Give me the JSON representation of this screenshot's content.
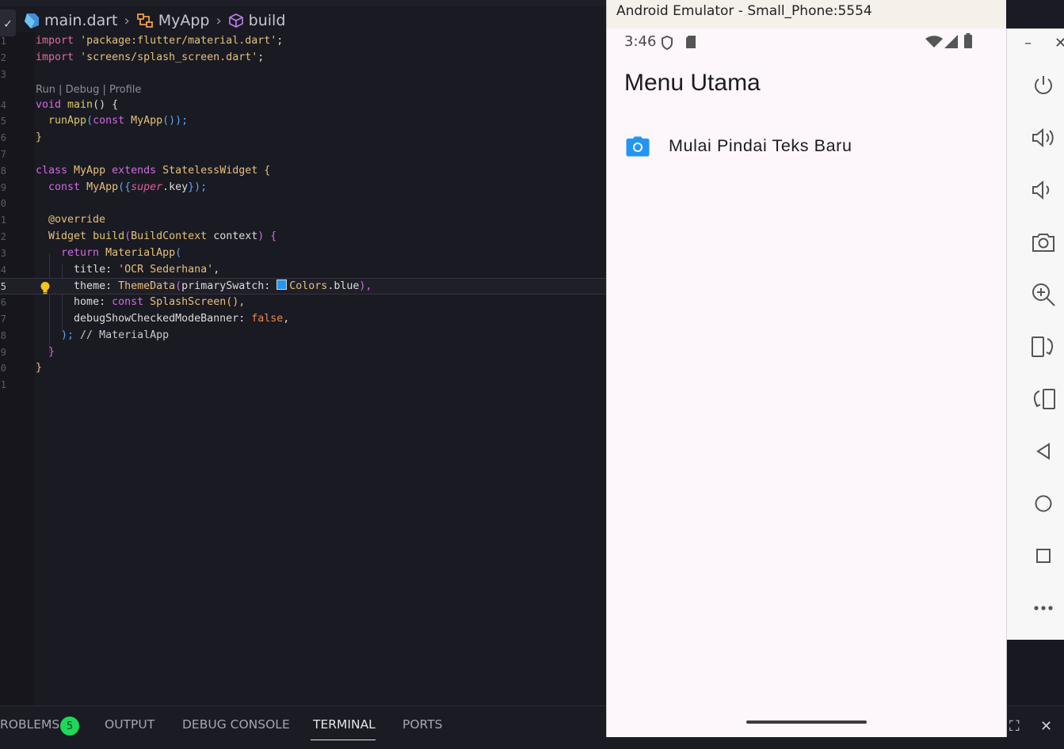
{
  "editor": {
    "breadcrumb": {
      "file": "main.dart",
      "class": "MyApp",
      "method": "build"
    },
    "codelens": "Run | Debug | Profile",
    "line_numbers": [
      "1",
      "2",
      "3",
      "4",
      "5",
      "6",
      "7",
      "8",
      "9",
      "0",
      "1",
      "2",
      "3",
      "4",
      "5",
      "6",
      "7",
      "8",
      "9",
      "0",
      "1"
    ],
    "code": {
      "l1_kw": "import",
      "l1_str": "'package:flutter/material.dart'",
      "l1_end": ";",
      "l2_kw": "import",
      "l2_str": "'screens/splash_screen.dart'",
      "l2_end": ";",
      "l4_a": "void ",
      "l4_b": "main",
      "l4_c": "() {",
      "l5_a": "runApp",
      "l5_b": "(",
      "l5_c": "const ",
      "l5_d": "MyApp",
      "l5_e": "());",
      "l6": "}",
      "l8_a": "class ",
      "l8_b": "MyApp ",
      "l8_c": "extends ",
      "l8_d": "StatelessWidget ",
      "l8_e": "{",
      "l9_a": "const ",
      "l9_b": "MyApp",
      "l9_c": "({",
      "l9_d": "super",
      "l9_e": ".key",
      "l9_f": "});",
      "l11": "@override",
      "l12_a": "Widget ",
      "l12_b": "build",
      "l12_c": "(",
      "l12_d": "BuildContext ",
      "l12_e": "context",
      "l12_f": ") {",
      "l13_a": "return ",
      "l13_b": "MaterialApp",
      "l13_c": "(",
      "l14_a": "title",
      "l14_b": ": ",
      "l14_c": "'OCR Sederhana'",
      "l14_d": ",",
      "l15_a": "theme",
      "l15_b": ": ",
      "l15_c": "ThemeData",
      "l15_d": "(",
      "l15_e": "primarySwatch",
      "l15_f": ": ",
      "l15_g": "Colors",
      "l15_h": ".blue",
      "l15_i": "),",
      "l16_a": "home",
      "l16_b": ": ",
      "l16_c": "const ",
      "l16_d": "SplashScreen",
      "l16_e": "(),",
      "l17_a": "debugShowCheckedModeBanner",
      "l17_b": ": ",
      "l17_c": "false",
      "l17_d": ",",
      "l18_a": ");",
      "l18_b": " // MaterialApp",
      "l19": "}",
      "l20": "}"
    }
  },
  "panel": {
    "tabs": [
      "ROBLEMS",
      "OUTPUT",
      "DEBUG CONSOLE",
      "TERMINAL",
      "PORTS"
    ],
    "active_tab": "TERMINAL",
    "problems_count": "5"
  },
  "emulator": {
    "window_title": "Android Emulator - Small_Phone:5554",
    "status_time": "3:46",
    "app_title": "Menu Utama",
    "list_item_label": "Mulai Pindai Teks Baru",
    "accent_color": "#2196f3",
    "sidebar_icons": [
      "minimize-icon",
      "close-icon",
      "power-icon",
      "volume-up-icon",
      "volume-down-icon",
      "camera-icon",
      "zoom-in-icon",
      "rotate-right-icon",
      "rotate-left-icon",
      "back-icon",
      "home-icon",
      "overview-icon",
      "more-icon"
    ]
  }
}
